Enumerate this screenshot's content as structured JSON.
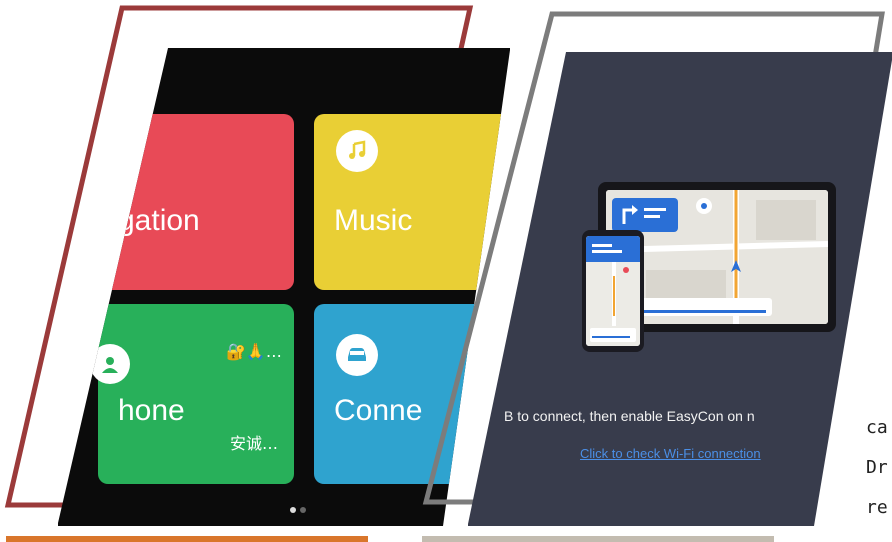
{
  "left_panel": {
    "tiles": {
      "navigation": {
        "label": "gation",
        "color": "#e84a57"
      },
      "music": {
        "label": "Music",
        "color": "#e9cf35"
      },
      "phone": {
        "label": "hone",
        "status_icons": "🔐🙏…",
        "subtitle": "安诚…",
        "color": "#28b05a"
      },
      "connect": {
        "label": "Conne",
        "color": "#2fa3cf"
      }
    },
    "page_dots": 2,
    "frame_color": "#9b3a3a"
  },
  "right_panel": {
    "instruction": "B to connect, then enable EasyCon on n",
    "link": "Click to check Wi-Fi connection",
    "background": "#383c4c",
    "frame_color": "#7c7c7c"
  },
  "edge_text": [
    "ca",
    "Dr",
    "re"
  ]
}
